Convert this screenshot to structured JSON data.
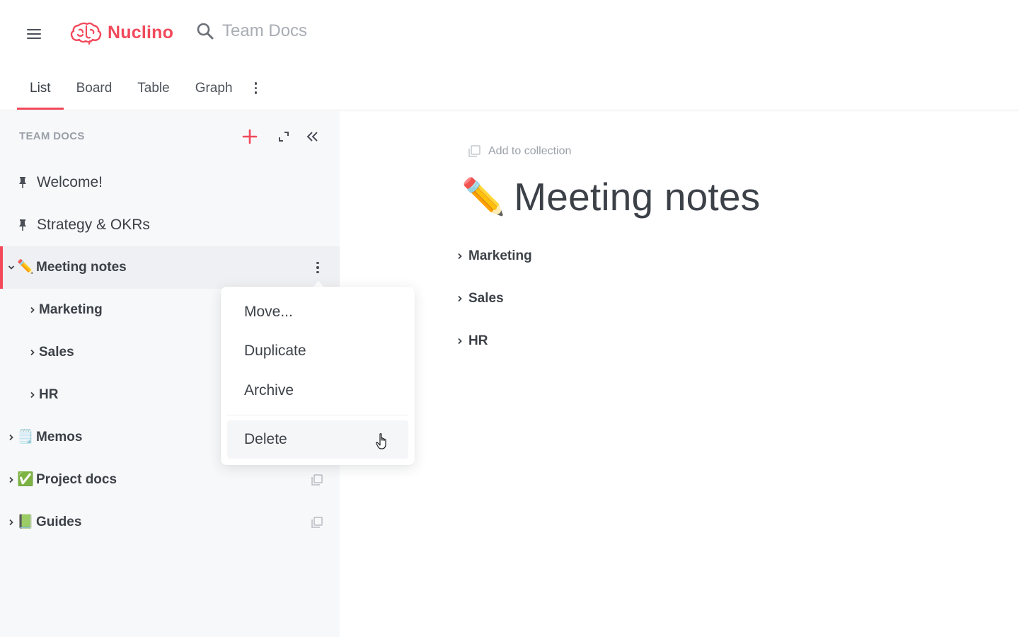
{
  "app": {
    "name": "Nuclino",
    "brand_color": "#f2495b"
  },
  "search": {
    "placeholder": "Team Docs"
  },
  "tabs": [
    {
      "label": "List",
      "active": true
    },
    {
      "label": "Board",
      "active": false
    },
    {
      "label": "Table",
      "active": false
    },
    {
      "label": "Graph",
      "active": false
    }
  ],
  "sidebar": {
    "header": "TEAM DOCS",
    "items": [
      {
        "label": "Welcome!",
        "icon": "pin-icon",
        "pinned": true
      },
      {
        "label": "Strategy & OKRs",
        "icon": "pin-icon",
        "pinned": true
      },
      {
        "label": "Meeting notes",
        "emoji": "✏️",
        "expanded": true,
        "selected": true,
        "children": [
          {
            "label": "Marketing"
          },
          {
            "label": "Sales"
          },
          {
            "label": "HR"
          }
        ]
      },
      {
        "label": "Memos",
        "emoji": "🗒️",
        "expanded": false
      },
      {
        "label": "Project docs",
        "emoji": "✅",
        "expanded": false
      },
      {
        "label": "Guides",
        "emoji": "📗",
        "expanded": false
      }
    ]
  },
  "context_menu": {
    "items": [
      {
        "label": "Move..."
      },
      {
        "label": "Duplicate"
      },
      {
        "label": "Archive"
      },
      {
        "label": "Delete",
        "hovered": true
      }
    ]
  },
  "document": {
    "add_to_collection": "Add to collection",
    "title_emoji": "✏️",
    "title": "Meeting notes",
    "children": [
      {
        "label": "Marketing"
      },
      {
        "label": "Sales"
      },
      {
        "label": "HR"
      }
    ]
  }
}
